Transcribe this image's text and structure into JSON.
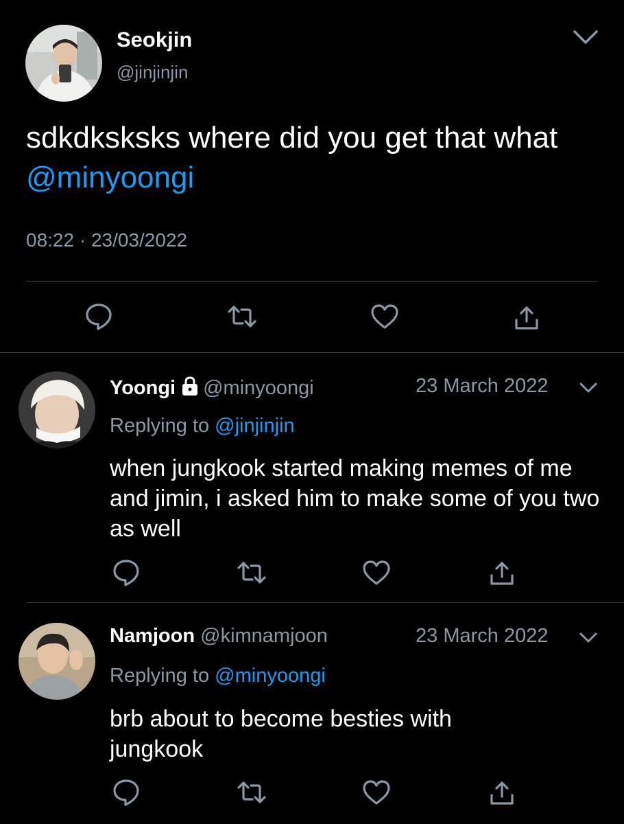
{
  "tweet": {
    "name": "Seokjin",
    "handle": "@jinjinjin",
    "text_before": "sdkdksksks where did you get that what ",
    "text_mention": "@minyoongi",
    "timestamp": "08:22 · 23/03/2022"
  },
  "replies": [
    {
      "name": "Yoongi",
      "protected": true,
      "handle": "@minyoongi",
      "date": "23 March 2022",
      "replying_prefix": "Replying to ",
      "replying_to": "@jinjinjin",
      "text": "when jungkook started making memes of me and jimin, i asked him to make some of you two as well"
    },
    {
      "name": "Namjoon",
      "protected": false,
      "handle": "@kimnamjoon",
      "date": "23 March 2022",
      "replying_prefix": "Replying to ",
      "replying_to": "@minyoongi",
      "text": "brb about to become besties with jungkook"
    }
  ],
  "icons": [
    "reply-icon",
    "retweet-icon",
    "like-icon",
    "share-icon",
    "chevron-down-icon",
    "lock-icon"
  ],
  "colors": {
    "background": "#000000",
    "text": "#ffffff",
    "secondary": "#8b98a5",
    "link": "#1d9bf0",
    "divider": "#38444d"
  }
}
